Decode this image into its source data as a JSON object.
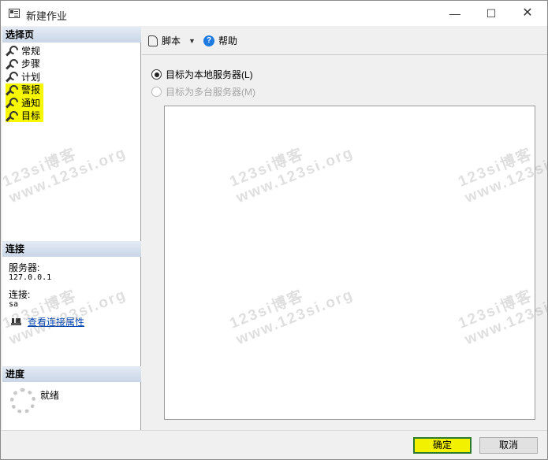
{
  "window": {
    "title": "新建作业",
    "minimize": "—",
    "maximize": "☐",
    "close": "✕"
  },
  "left": {
    "select_page_header": "选择页",
    "pages": [
      {
        "label": "常规",
        "icon": "wrench-icon",
        "highlighted": false
      },
      {
        "label": "步骤",
        "icon": "wrench-icon",
        "highlighted": false
      },
      {
        "label": "计划",
        "icon": "wrench-icon",
        "highlighted": false
      },
      {
        "label": "警报",
        "icon": "wrench-icon",
        "highlighted": true
      },
      {
        "label": "通知",
        "icon": "wrench-icon",
        "highlighted": true
      },
      {
        "label": "目标",
        "icon": "wrench-icon",
        "highlighted": true
      }
    ],
    "connection_header": "连接",
    "server_label": "服务器:",
    "server_value": "127.0.0.1",
    "connection_label": "连接:",
    "connection_value": "sa",
    "view_connection_link": "查看连接属性",
    "progress_header": "进度",
    "progress_status": "就绪"
  },
  "toolbar": {
    "script_label": "脚本",
    "help_label": "帮助"
  },
  "targets": {
    "local_server_option": "目标为本地服务器(L)",
    "local_server_selected": true,
    "multi_server_option": "目标为多台服务器(M)",
    "multi_server_enabled": false
  },
  "buttons": {
    "ok": "确定",
    "cancel": "取消"
  },
  "colors": {
    "highlight": "#f7f700",
    "section_header": "#c9d6e7",
    "ok_border": "#2c7a2c",
    "link": "#0645ad"
  },
  "watermark": {
    "line1": "123si博客",
    "line2": "www.123si.org"
  }
}
